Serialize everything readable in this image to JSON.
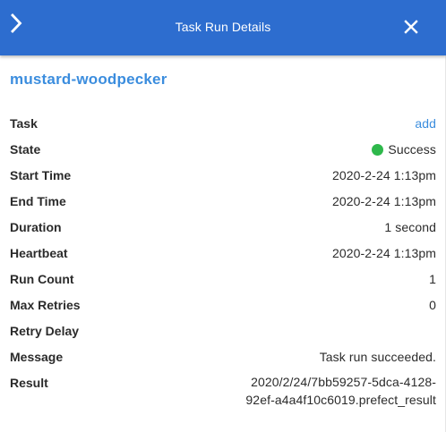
{
  "header": {
    "title": "Task Run Details"
  },
  "run": {
    "name": "mustard-woodpecker"
  },
  "details": {
    "task": {
      "label": "Task",
      "value": "add"
    },
    "state": {
      "label": "State",
      "value": "Success",
      "color": "#2eb84b"
    },
    "start_time": {
      "label": "Start Time",
      "value": "2020-2-24 1:13pm"
    },
    "end_time": {
      "label": "End Time",
      "value": "2020-2-24 1:13pm"
    },
    "duration": {
      "label": "Duration",
      "value": "1 second"
    },
    "heartbeat": {
      "label": "Heartbeat",
      "value": "2020-2-24 1:13pm"
    },
    "run_count": {
      "label": "Run Count",
      "value": "1"
    },
    "max_retries": {
      "label": "Max Retries",
      "value": "0"
    },
    "retry_delay": {
      "label": "Retry Delay",
      "value": ""
    },
    "message": {
      "label": "Message",
      "value": "Task run succeeded."
    },
    "result": {
      "label": "Result",
      "value_line1": "2020/2/24/7bb59257-5dca-4128-",
      "value_line2": "92ef-a4a4f10c6019.prefect_result"
    }
  },
  "icons": {
    "expand": "chevron-right-icon",
    "close": "close-icon"
  },
  "colors": {
    "header_bg": "#2d6dcf",
    "accent": "#3b8dde",
    "success": "#2eb84b"
  }
}
